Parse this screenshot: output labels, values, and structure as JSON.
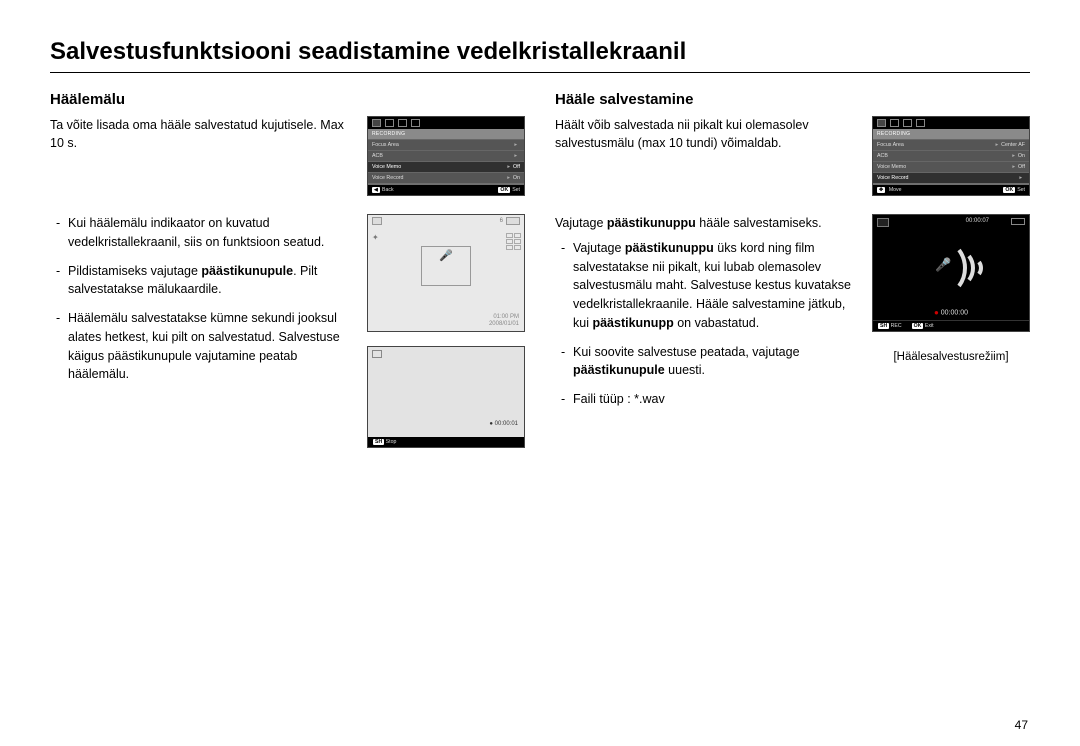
{
  "page": {
    "title": "Salvestusfunktsiooni seadistamine vedelkristallekraanil",
    "number": "47"
  },
  "left": {
    "heading": "Häälemälu",
    "intro": "Ta võite lisada oma hääle salvestatud kujutisele. Max 10 s.",
    "bullets": [
      {
        "plain": "Kui häälemälu indikaator on kuvatud vedelkristallekraanil, siis on funktsioon seatud."
      },
      {
        "pre": "Pildistamiseks vajutage ",
        "bold": "päästikunupule",
        "post": ". Pilt salvestatakse mälukaardile."
      },
      {
        "plain": "Häälemälu salvestatakse kümne sekundi jooksul alates hetkest, kui pilt on salvestatud. Salvestuse käigus päästikunupule vajutamine peatab häälemälu."
      }
    ],
    "menu": {
      "header": "RECORDING",
      "rows": [
        {
          "label": "Focus Area",
          "value": ""
        },
        {
          "label": "ACB",
          "value": ""
        },
        {
          "label": "Voice Memo",
          "value": "Off",
          "sel": true
        },
        {
          "label": "Voice Record",
          "value": "On"
        }
      ],
      "footer_left": "Back",
      "footer_right_key": "OK",
      "footer_right": "Set"
    },
    "preview": {
      "count": "6",
      "time": "01:00 PM",
      "date": "2008/01/01"
    },
    "rec": {
      "timer": "00:00:01",
      "btn_key": "SH",
      "btn_label": "Stop"
    }
  },
  "right": {
    "heading": "Hääle salvestamine",
    "intro": "Häält võib salvestada nii pikalt kui olemasolev salvestusmälu (max 10 tundi) võimaldab.",
    "lead_pre": "Vajutage ",
    "lead_bold": "päästikunuppu",
    "lead_post": " hääle salvestamiseks.",
    "bullets": [
      {
        "pre": "Vajutage ",
        "bold": "päästikunuppu",
        "mid": " üks kord ning film salvestatakse nii pikalt, kui lubab olemasolev salvestusmälu maht. Salvestuse kestus kuvatakse vedelkristallekraanile. Hääle salvestamine jätkub, kui ",
        "bold2": "päästikunupp",
        "post": " on vabastatud."
      },
      {
        "pre": "Kui soovite salvestuse peatada, vajutage ",
        "bold": "päästikunupule",
        "post": " uuesti."
      },
      {
        "plain": "Faili tüüp : *.wav"
      }
    ],
    "menu": {
      "header": "RECORDING",
      "rows": [
        {
          "label": "Focus Area",
          "value": "Center AF"
        },
        {
          "label": "ACB",
          "value": "On"
        },
        {
          "label": "Voice Memo",
          "value": "Off"
        },
        {
          "label": "Voice Record",
          "value": "",
          "sel": true
        }
      ],
      "footer_left": "Move",
      "footer_right_key": "OK",
      "footer_right": "Set"
    },
    "voice": {
      "elapsed": "00:00:07",
      "center_time": "00:00:00",
      "bot_rec_key": "SH",
      "bot_rec": "REC",
      "bot_exit_key": "OK",
      "bot_exit": "Exit",
      "caption": "[Häälesalvestusrežiim]"
    }
  }
}
